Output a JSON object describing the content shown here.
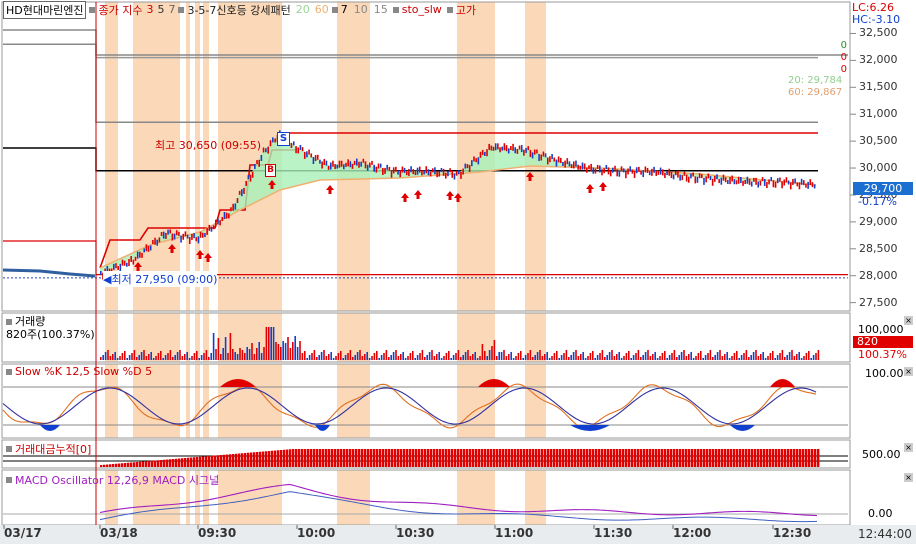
{
  "stock_name": "HD현대마린엔진",
  "price_legend": {
    "ma_label": "종가 지수",
    "ma_periods": [
      "3",
      "5",
      "7"
    ],
    "pattern_label": "3-5-7신호등 강세패턴",
    "pattern_periods": [
      "20",
      "60"
    ],
    "stoch_periods": [
      "7",
      "10",
      "15"
    ],
    "stoch_label": "sto_slw",
    "high_label": "고가"
  },
  "corner": {
    "lc": "LC:6.26",
    "hc": "HC:-3.10"
  },
  "price_axis": {
    "ticks": [
      "32,500",
      "32,000",
      "31,500",
      "31,000",
      "30,500",
      "30,000",
      "29,500",
      "29,000",
      "28,500",
      "28,000",
      "27,500"
    ],
    "current_price": "29,700",
    "change_pct": "-0.17%",
    "zero_marks": [
      "0",
      "0",
      "0"
    ],
    "ma20_label": "20: 29,784",
    "ma60_label": "60: 29,867"
  },
  "annotations": {
    "high": "최고 30,650 (09:55)",
    "low": "최저 27,950 (09:00)",
    "sell_marker": "S",
    "buy_marker": "B"
  },
  "volume_panel": {
    "title": "거래량",
    "value": "820주(100.37%)",
    "axis_top": "100,000",
    "current": "820",
    "current_pct": "100.37%"
  },
  "stoch_panel": {
    "title": "Slow %K 12,5  Slow %D 5",
    "axis_top": "100.00"
  },
  "cum_panel": {
    "title": "거래대금누적[0]",
    "axis_label": "500.00"
  },
  "macd_panel": {
    "title": "MACD Oscillator 12,26,9  MACD  시그널",
    "axis_label": "0.00"
  },
  "time_axis": {
    "labels": [
      "03/17",
      "03/18",
      "09:30",
      "10:00",
      "10:30",
      "11:00",
      "11:30",
      "12:00",
      "12:30"
    ],
    "current_time": "12:44:00"
  },
  "colors": {
    "up": "#e00000",
    "down": "#1040d0",
    "shade": "#fbd9b8",
    "ma_fill": "#a8f0b8",
    "price_badge": "#1c6fd1"
  },
  "chart_data": [
    {
      "type": "line",
      "name": "price",
      "x": [
        "09:00",
        "09:10",
        "09:20",
        "09:30",
        "09:40",
        "09:50",
        "09:55",
        "10:00",
        "10:10",
        "10:20",
        "10:30",
        "10:40",
        "10:50",
        "11:00",
        "11:10",
        "11:20",
        "11:30",
        "11:40",
        "11:50",
        "12:00",
        "12:10",
        "12:20",
        "12:30",
        "12:40"
      ],
      "values": [
        28050,
        28300,
        28800,
        28700,
        29200,
        30300,
        30650,
        30400,
        30050,
        30100,
        29950,
        29950,
        29900,
        30400,
        30350,
        30150,
        30000,
        29950,
        29950,
        29850,
        29800,
        29750,
        29750,
        29700
      ],
      "ylim": [
        27400,
        32750
      ],
      "reference_lines": [
        32300,
        32050,
        30850,
        30650,
        29950,
        28020,
        27960
      ]
    },
    {
      "type": "bar",
      "name": "volume",
      "ylim": [
        0,
        100000
      ]
    },
    {
      "type": "line",
      "name": "stochastic",
      "ylim": [
        0,
        100
      ]
    },
    {
      "type": "bar",
      "name": "cumulative_trade_value",
      "axis": "500.00"
    },
    {
      "type": "line",
      "name": "macd",
      "axis": "0.00"
    }
  ]
}
